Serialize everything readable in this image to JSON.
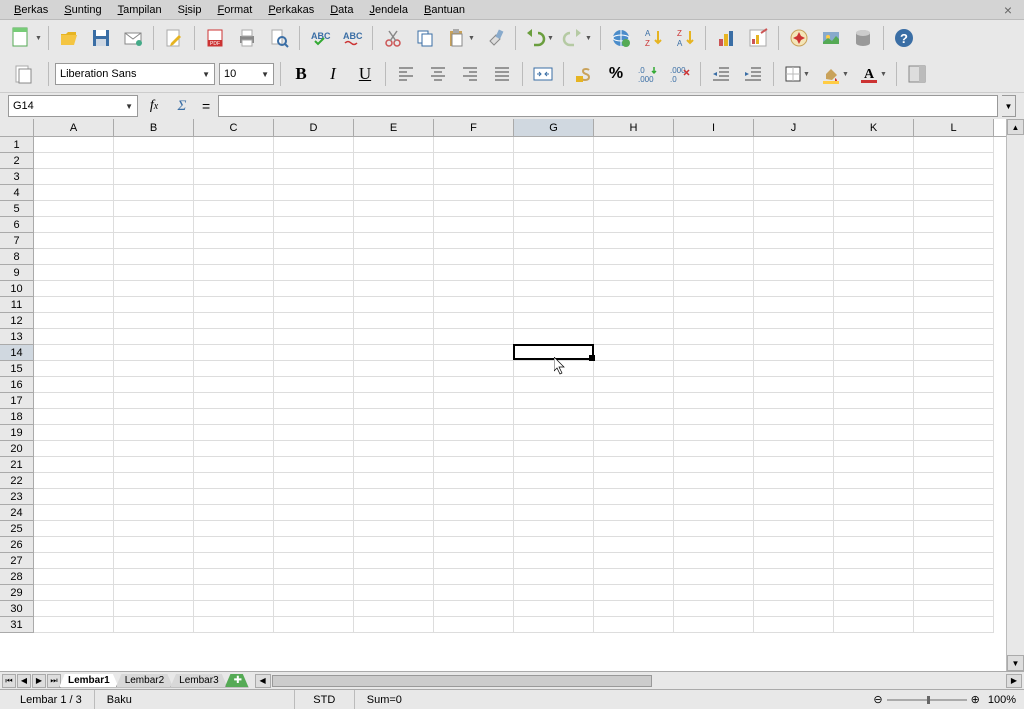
{
  "menu": [
    "Berkas",
    "Sunting",
    "Tampilan",
    "Sisip",
    "Format",
    "Perkakas",
    "Data",
    "Jendela",
    "Bantuan"
  ],
  "menu_underlines": [
    "B",
    "S",
    "T",
    "S",
    "F",
    "P",
    "D",
    "J",
    "B"
  ],
  "font": {
    "name": "Liberation Sans",
    "size": "10"
  },
  "namebox": "G14",
  "formula_value": "",
  "columns": [
    "A",
    "B",
    "C",
    "D",
    "E",
    "F",
    "G",
    "H",
    "I",
    "J",
    "K",
    "L"
  ],
  "rows": [
    1,
    2,
    3,
    4,
    5,
    6,
    7,
    8,
    9,
    10,
    11,
    12,
    13,
    14,
    15,
    16,
    17,
    18,
    19,
    20,
    21,
    22,
    23,
    24,
    25,
    26,
    27,
    28,
    29,
    30,
    31
  ],
  "active_col": "G",
  "active_row": 14,
  "sheets": {
    "tabs": [
      "Lembar1",
      "Lembar2",
      "Lembar3"
    ],
    "active": 0
  },
  "status": {
    "sheet": "Lembar 1 / 3",
    "style": "Baku",
    "mode": "STD",
    "sum": "Sum=0",
    "zoom": "100%"
  },
  "icons": {
    "new": "new-doc-icon",
    "open": "open-icon",
    "save": "save-icon",
    "mail": "mail-icon",
    "edit": "edit-icon",
    "pdf": "pdf-icon",
    "print": "print-icon",
    "preview": "preview-icon",
    "spell": "spellcheck-icon",
    "auto": "autospell-icon",
    "cut": "cut-icon",
    "copy": "copy-icon",
    "paste": "paste-icon",
    "format_paint": "format-paint-icon",
    "undo": "undo-icon",
    "redo": "redo-icon",
    "hyperlink": "hyperlink-icon",
    "sortasc": "sort-asc-icon",
    "sortdesc": "sort-desc-icon",
    "chart": "chart-icon",
    "chartbar": "chartbar-icon",
    "nav": "navigator-icon",
    "gallery": "gallery-icon",
    "datasrc": "datasource-icon",
    "help": "help-icon",
    "bold": "bold-icon",
    "italic": "italic-icon",
    "underline": "underline-icon",
    "align_l": "align-left-icon",
    "align_c": "align-center-icon",
    "align_r": "align-right-icon",
    "align_j": "align-justify-icon",
    "merge": "merge-icon",
    "currency": "currency-icon",
    "percent": "percent-icon",
    "dec_add": "decimal-add-icon",
    "dec_rem": "decimal-remove-icon",
    "indent_dec": "indent-decrease-icon",
    "indent_inc": "indent-increase-icon",
    "border": "border-icon",
    "bg": "bgcolor-icon",
    "fg": "fontcolor-icon",
    "sidepanel": "sidepanel-icon",
    "grid": "grid-icon"
  }
}
